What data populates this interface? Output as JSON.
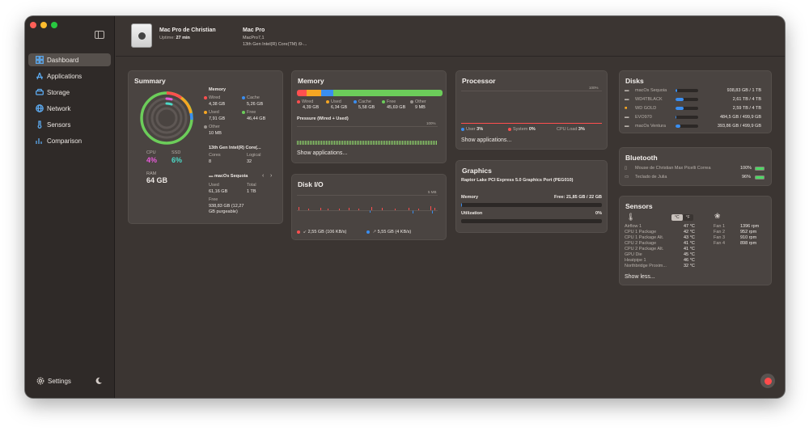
{
  "sidebar": {
    "items": [
      {
        "label": "Dashboard"
      },
      {
        "label": "Applications"
      },
      {
        "label": "Storage"
      },
      {
        "label": "Network"
      },
      {
        "label": "Sensors"
      },
      {
        "label": "Comparison"
      }
    ],
    "settings_label": "Settings"
  },
  "header": {
    "name": "Mac Pro de Christian",
    "uptime_label": "Uptime:",
    "uptime_value": "27 min",
    "model": "Mac Pro",
    "model_id": "MacPro7,1",
    "cpu": "13th Gen Intel(R) Core(TM) i9-..."
  },
  "summary": {
    "title": "Summary",
    "cpu_label": "CPU",
    "cpu_value": "4%",
    "ssd_label": "SSD",
    "ssd_value": "6%",
    "ram_label": "RAM",
    "ram_value": "64 GB",
    "memory_title": "Memory",
    "wired_label": "Wired",
    "wired_value": "4,38 GB",
    "cache_label": "Cache",
    "cache_value": "5,26 GB",
    "used_label": "Used",
    "used_value": "7,91 GB",
    "free_label": "Free",
    "free_value": "46,44 GB",
    "other_label": "Other",
    "other_value": "10 MB",
    "cpu_title": "13th Gen Intel(R) Core(...",
    "cores_label": "Cores",
    "cores_value": "8",
    "logical_label": "Logical",
    "logical_value": "32",
    "disk_title": "macOs Sequoia",
    "disk_used_label": "Used",
    "disk_used_value": "61,16 GB",
    "disk_total_label": "Total",
    "disk_total_value": "1 TB",
    "disk_free_label": "Free",
    "disk_free_value_1": "938,83 GB (12,27",
    "disk_free_value_2": "GB purgeable)"
  },
  "memory": {
    "title": "Memory",
    "wired_label": "Wired",
    "wired_value": "4,39 GB",
    "used_label": "Used",
    "used_value": "6,34 GB",
    "cache_label": "Cache",
    "cache_value": "5,58 GB",
    "free_label": "Free",
    "free_value": "45,69 GB",
    "other_label": "Other",
    "other_value": "9 MB",
    "pressure_label": "Pressure (Wired + Used)",
    "pressure_max": "100%",
    "show_label": "Show applications..."
  },
  "processor": {
    "title": "Processor",
    "max": "100%",
    "user_label": "User",
    "user_value": "3%",
    "system_label": "System",
    "system_value": "0%",
    "load_label": "CPU Load",
    "load_value": "3%",
    "show_label": "Show applications..."
  },
  "graphics": {
    "title": "Graphics",
    "gpu_name": "Raptor Lake PCI Express 5.0 Graphics Port (PEG010)",
    "memory_label": "Memory",
    "memory_value": "Free: 21,85 GB / 22 GB",
    "util_label": "Utilization",
    "util_value": "0%"
  },
  "diskio": {
    "title": "Disk I/O",
    "max": "5 MB",
    "read_value": "2,55 GB (106 KB/s)",
    "write_value": "5,55 GB (4 KB/s)"
  },
  "disks": {
    "title": "Disks",
    "items": [
      {
        "name": "macOs Sequoia",
        "value": "938,83 GB / 1 TB",
        "fill": 0.06
      },
      {
        "name": "WD4TBLACK",
        "value": "2,61 TB / 4 TB",
        "fill": 0.35
      },
      {
        "name": "WD GOLD",
        "value": "2,59 TB / 4 TB",
        "fill": 0.35
      },
      {
        "name": "EVO970",
        "value": "484,5 GB / 499,9 GB",
        "fill": 0.03
      },
      {
        "name": "macOs Ventura",
        "value": "393,86 GB / 499,9 GB",
        "fill": 0.21
      }
    ]
  },
  "bluetooth": {
    "title": "Bluetooth",
    "items": [
      {
        "name": "Mouse de Christian Max Picelli Correa",
        "value": "100%",
        "fill": 1.0
      },
      {
        "name": "Teclado de Julia",
        "value": "96%",
        "fill": 0.96
      }
    ]
  },
  "sensors": {
    "title": "Sensors",
    "unit_c": "°C",
    "unit_f": "°F",
    "temps": [
      {
        "name": "Airflow 1",
        "value": "47 °C"
      },
      {
        "name": "CPU 1 Package",
        "value": "42 °C"
      },
      {
        "name": "CPU 1 Package Alt.",
        "value": "43 °C"
      },
      {
        "name": "CPU 2 Package",
        "value": "41 °C"
      },
      {
        "name": "CPU 2 Package Alt.",
        "value": "41 °C"
      },
      {
        "name": "GPU Die",
        "value": "45 °C"
      },
      {
        "name": "Heatpipe 1",
        "value": "46 °C"
      },
      {
        "name": "Northbridge Proxim...",
        "value": "32 °C"
      }
    ],
    "fans": [
      {
        "name": "Fan 1",
        "value": "1396 rpm"
      },
      {
        "name": "Fan 2",
        "value": "952 rpm"
      },
      {
        "name": "Fan 3",
        "value": "910 rpm"
      },
      {
        "name": "Fan 4",
        "value": "898 rpm"
      }
    ],
    "show_less": "Show less..."
  },
  "colors": {
    "accent": "#3a8ef0",
    "wired": "#ff4f4f",
    "used": "#f5a623",
    "cache": "#3a8ef0",
    "free": "#6ccd5a",
    "other": "#9b9590",
    "cpu_pink": "#e85ad9",
    "ssd_teal": "#4cd9c7"
  }
}
